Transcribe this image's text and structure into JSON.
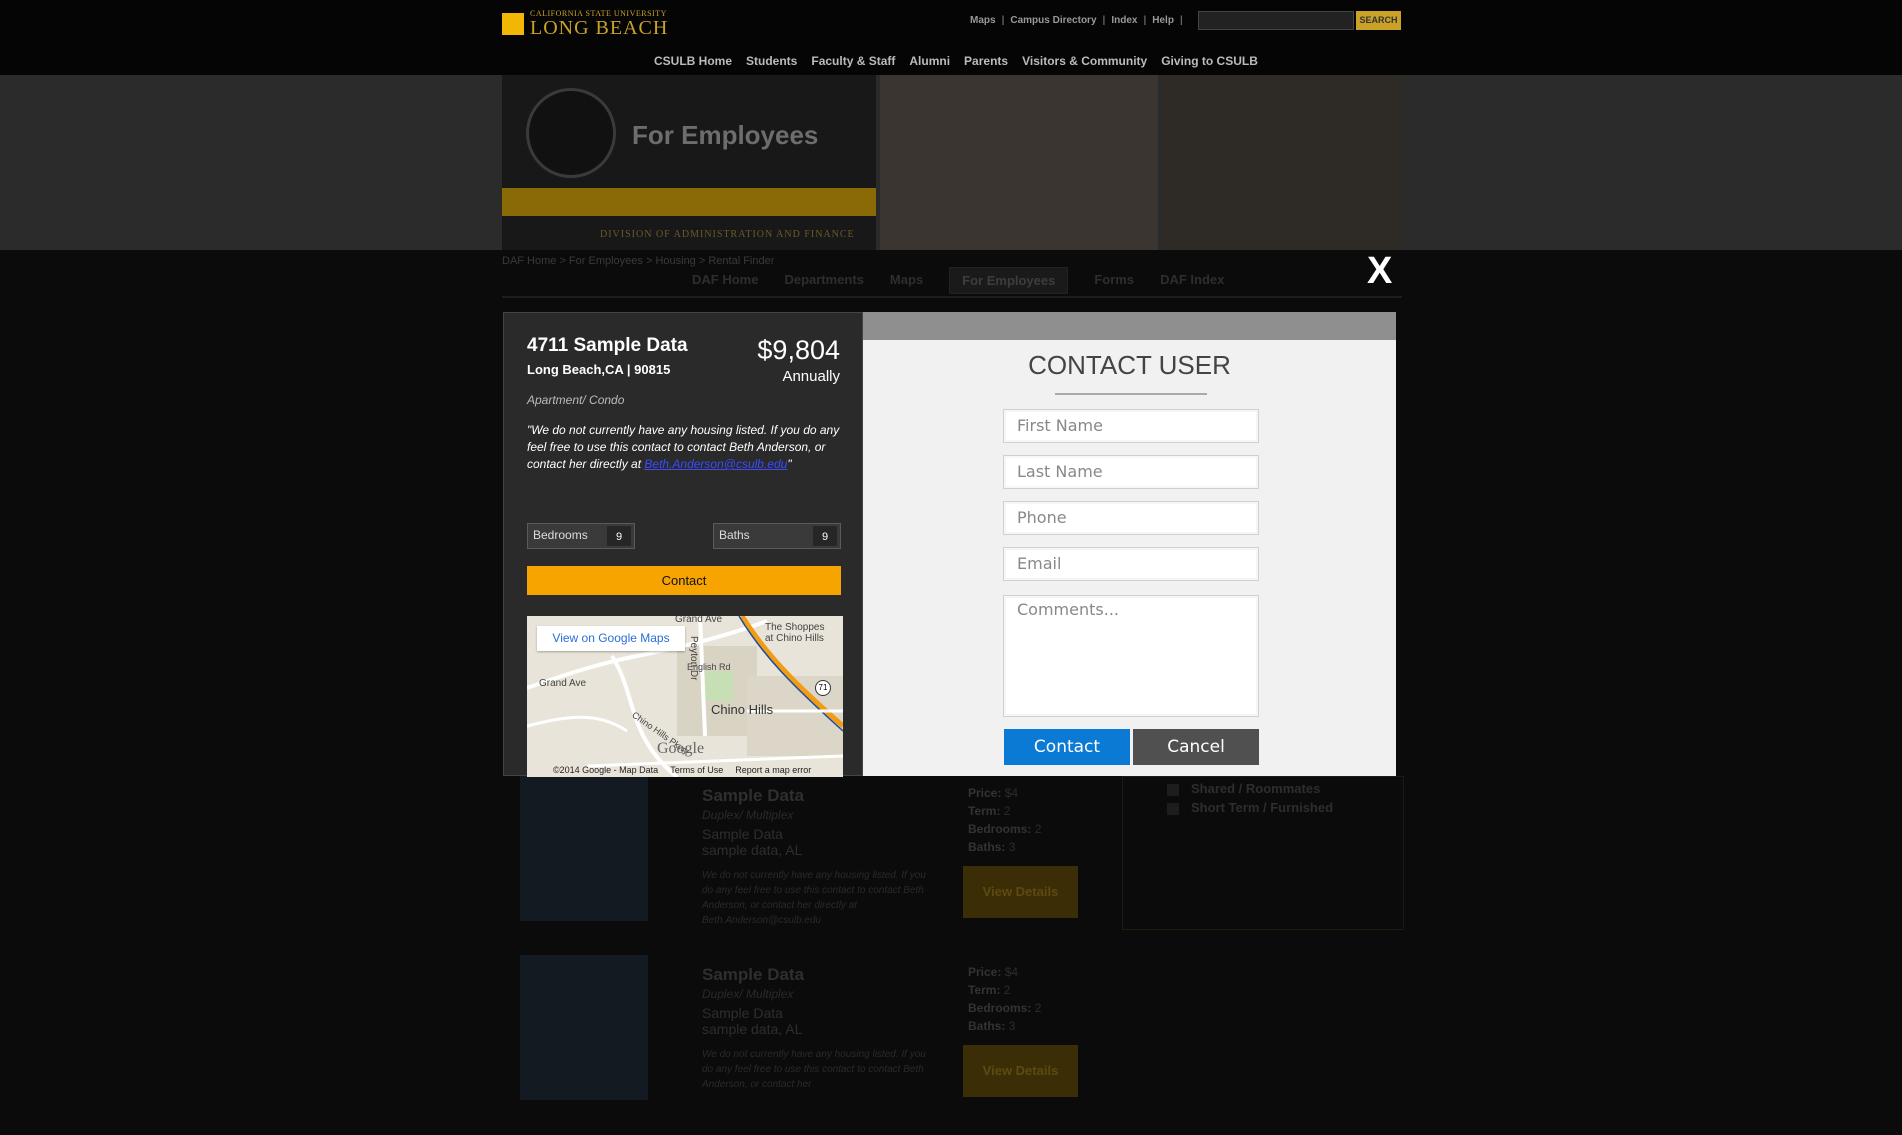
{
  "header": {
    "logo_small": "CALIFORNIA STATE UNIVERSITY",
    "logo_big": "LONG BEACH",
    "util_links": [
      "Maps",
      "Campus Directory",
      "Index",
      "Help"
    ],
    "search_button": "SEARCH",
    "nav": [
      "CSULB Home",
      "Students",
      "Faculty & Staff",
      "Alumni",
      "Parents",
      "Visitors & Community",
      "Giving to CSULB"
    ]
  },
  "banner": {
    "title": "For Employees",
    "division": "DIVISION OF ADMINISTRATION AND FINANCE"
  },
  "breadcrumb": "DAF Home > For Employees > Housing > Rental Finder",
  "subtabs": [
    "DAF Home",
    "Departments",
    "Maps",
    "For Employees",
    "Forms",
    "DAF Index"
  ],
  "listings": [
    {
      "title": "Sample Data",
      "type": "Duplex/ Multiplex",
      "addr1": "Sample Data",
      "addr2": "sample data, AL",
      "desc": "We do not currently have any housing listed. If you do any feel free to use this contact to contact Beth Anderson, or contact her directly at Beth.Anderson@csulb.edu",
      "price_label": "Price:",
      "price": "$4",
      "term_label": "Term:",
      "term": "2",
      "bed_label": "Bedrooms:",
      "bed": "2",
      "bath_label": "Baths:",
      "bath": "3",
      "button": "View Details"
    },
    {
      "title": "Sample Data",
      "type": "Duplex/ Multiplex",
      "addr1": "Sample Data",
      "addr2": "sample data, AL",
      "desc": "We do not currently have any housing listed. If you do any feel free to use this contact to contact Beth Anderson, or contact her",
      "price_label": "Price:",
      "price": "$4",
      "term_label": "Term:",
      "term": "2",
      "bed_label": "Bedrooms:",
      "bed": "2",
      "bath_label": "Baths:",
      "bath": "3",
      "button": "View Details"
    }
  ],
  "filters": [
    "Shared / Roommates",
    "Short Term / Furnished"
  ],
  "modal": {
    "close": "X",
    "property": {
      "title": "4711 Sample Data",
      "address": "Long Beach,CA | 90815",
      "price": "$9,804",
      "period": "Annually",
      "type": "Apartment/ Condo",
      "desc": "\"We do not currently have any housing listed. If you do any feel free to use this contact to contact Beth Anderson, or contact her directly at ",
      "email": "Beth.Anderson@csulb.edu",
      "desc_end": "\"",
      "bedrooms_label": "Bedrooms",
      "bedrooms": "9",
      "baths_label": "Baths",
      "baths": "9",
      "contact_button": "Contact"
    },
    "map": {
      "view_button": "View on Google Maps",
      "labels": [
        "Grand Ave",
        "Peyton Dr",
        "The Shoppes",
        "at Chino Hills",
        "English Rd",
        "Grand Ave",
        "Chino Hills Pkwy",
        "71"
      ],
      "city": "Chino Hills",
      "brand": "Google",
      "footer": [
        "©2014 Google - Map Data",
        "Terms of Use",
        "Report a map error"
      ]
    },
    "form": {
      "title": "CONTACT USER",
      "first_name_placeholder": "First Name",
      "last_name_placeholder": "Last Name",
      "phone_placeholder": "Phone",
      "email_placeholder": "Email",
      "comments_placeholder": "Comments...",
      "contact_button": "Contact",
      "cancel_button": "Cancel"
    }
  }
}
